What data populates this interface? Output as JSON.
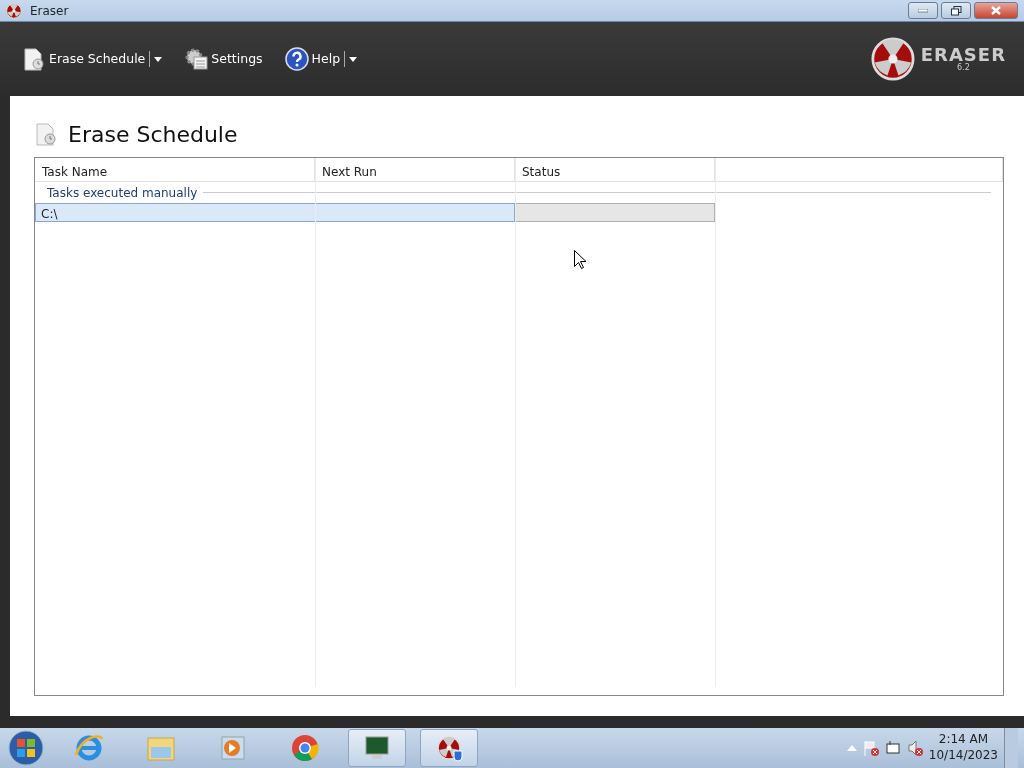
{
  "window": {
    "title": "Eraser"
  },
  "toolbar": [
    {
      "label": "Erase Schedule",
      "kind": "schedule",
      "dropdown": true
    },
    {
      "label": "Settings",
      "kind": "settings",
      "dropdown": false
    },
    {
      "label": "Help",
      "kind": "help",
      "dropdown": true
    }
  ],
  "logo": {
    "name": "ERASER",
    "version": "6.2"
  },
  "page": {
    "title": "Erase Schedule"
  },
  "table": {
    "columns": [
      "Task Name",
      "Next Run",
      "Status"
    ],
    "groups": [
      {
        "label": "Tasks executed manually",
        "rows": [
          {
            "task_name": "C:\\",
            "next_run": "",
            "selected": true,
            "level": 0
          }
        ]
      }
    ]
  },
  "taskbar": {
    "apps": [
      {
        "kind": "ie",
        "active": false
      },
      {
        "kind": "explorer",
        "active": false
      },
      {
        "kind": "media",
        "active": false
      },
      {
        "kind": "chrome",
        "active": false
      },
      {
        "kind": "monitor",
        "active": true
      },
      {
        "kind": "eraser",
        "active": true
      }
    ],
    "time": "2:14 AM",
    "date": "10/14/2023"
  }
}
